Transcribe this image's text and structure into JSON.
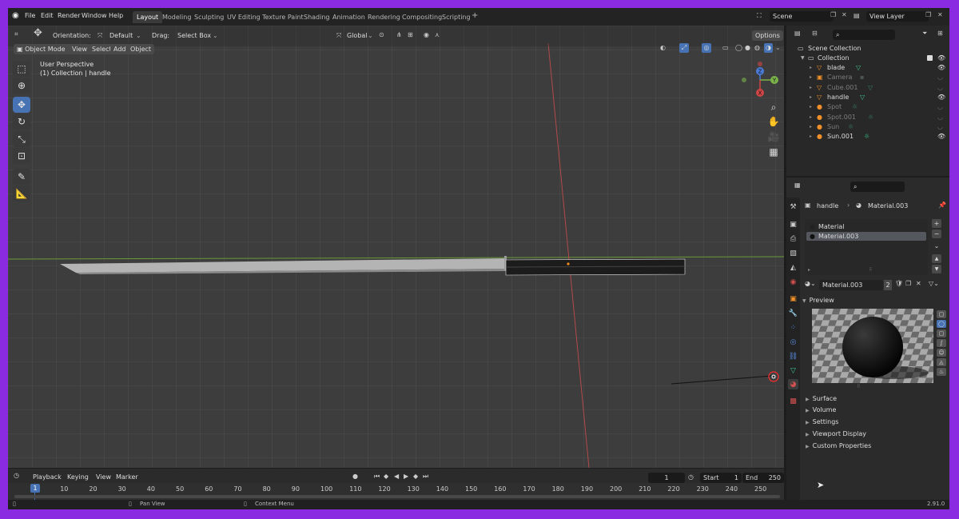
{
  "menu": [
    "File",
    "Edit",
    "Render",
    "Window",
    "Help"
  ],
  "workspaces": [
    "Layout",
    "Modeling",
    "Sculpting",
    "UV Editing",
    "Texture Paint",
    "Shading",
    "Animation",
    "Rendering",
    "Compositing",
    "Scripting"
  ],
  "workspace_add": "+",
  "scene": {
    "label": "Scene",
    "view_layer": "View Layer"
  },
  "header": {
    "orientation_label": "Orientation:",
    "orientation_value": "Default",
    "drag_label": "Drag:",
    "drag_value": "Select Box",
    "transform_orientation": "Global",
    "options": "Options"
  },
  "viewport_header": {
    "mode": "Object Mode",
    "menus": [
      "View",
      "Select",
      "Add",
      "Object"
    ]
  },
  "viewport": {
    "perspective": "User Perspective",
    "collection_info": "(1) Collection | handle"
  },
  "gizmo": {
    "z": "Z",
    "y": "Y",
    "x": "X"
  },
  "outliner": {
    "root": "Scene Collection",
    "collection": "Collection",
    "items": [
      {
        "name": "blade",
        "dim": false
      },
      {
        "name": "Camera",
        "dim": true
      },
      {
        "name": "Cube.001",
        "dim": true
      },
      {
        "name": "handle",
        "dim": false
      },
      {
        "name": "Spot",
        "dim": true
      },
      {
        "name": "Spot.001",
        "dim": true
      },
      {
        "name": "Sun",
        "dim": true
      },
      {
        "name": "Sun.001",
        "dim": false
      }
    ]
  },
  "properties": {
    "object_name": "handle",
    "material_name": "Material.003",
    "slots": [
      "Material",
      "Material.003"
    ],
    "material_field": "Material.003",
    "users": "2",
    "preview_label": "Preview",
    "panels": [
      "Surface",
      "Volume",
      "Settings",
      "Viewport Display",
      "Custom Properties"
    ]
  },
  "timeline": {
    "menus": [
      "Playback",
      "Keying",
      "View",
      "Marker"
    ],
    "current_frame": "1",
    "start_label": "Start",
    "start_value": "1",
    "end_label": "End",
    "end_value": "250",
    "ruler": [
      "10",
      "20",
      "30",
      "40",
      "50",
      "60",
      "70",
      "80",
      "90",
      "100",
      "110",
      "120",
      "130",
      "140",
      "150",
      "160",
      "170",
      "180",
      "190",
      "200",
      "210",
      "220",
      "230",
      "240",
      "250"
    ],
    "playhead_label": "1"
  },
  "status": {
    "pan": "Pan View",
    "context": "Context Menu",
    "version": "2.91.0"
  }
}
